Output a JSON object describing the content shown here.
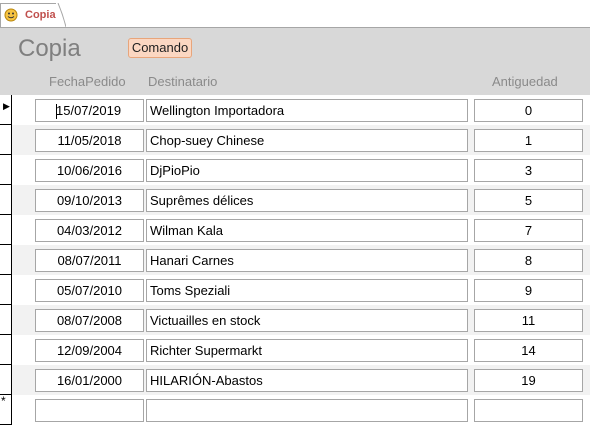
{
  "tab": {
    "label": "Copia",
    "icon": "form-smiley-icon"
  },
  "header": {
    "title": "Copia",
    "command_label": "Comando",
    "columns": {
      "fecha": "FechaPedido",
      "destinatario": "Destinatario",
      "antiguedad": "Antiguedad"
    }
  },
  "rows": [
    {
      "fecha": "15/07/2019",
      "destinatario": "Wellington Importadora",
      "antiguedad": "0"
    },
    {
      "fecha": "11/05/2018",
      "destinatario": "Chop-suey Chinese",
      "antiguedad": "1"
    },
    {
      "fecha": "10/06/2016",
      "destinatario": "DjPioPio",
      "antiguedad": "3"
    },
    {
      "fecha": "09/10/2013",
      "destinatario": "Suprêmes délices",
      "antiguedad": "5"
    },
    {
      "fecha": "04/03/2012",
      "destinatario": "Wilman Kala",
      "antiguedad": "7"
    },
    {
      "fecha": "08/07/2011",
      "destinatario": "Hanari Carnes",
      "antiguedad": "8"
    },
    {
      "fecha": "05/07/2010",
      "destinatario": "Toms Speziali",
      "antiguedad": "9"
    },
    {
      "fecha": "08/07/2008",
      "destinatario": "Victuailles en stock",
      "antiguedad": "11"
    },
    {
      "fecha": "12/09/2004",
      "destinatario": "Richter Supermarkt",
      "antiguedad": "14"
    },
    {
      "fecha": "16/01/2000",
      "destinatario": "HILARIÓN-Abastos",
      "antiguedad": "19"
    }
  ],
  "selectors": {
    "current": "▶",
    "new": "*"
  },
  "colors": {
    "tab_label": "#c0504d",
    "header_bg": "#d8d8d8",
    "button_bg": "#fbd7c2",
    "alt_row": "#f2f2f2"
  }
}
